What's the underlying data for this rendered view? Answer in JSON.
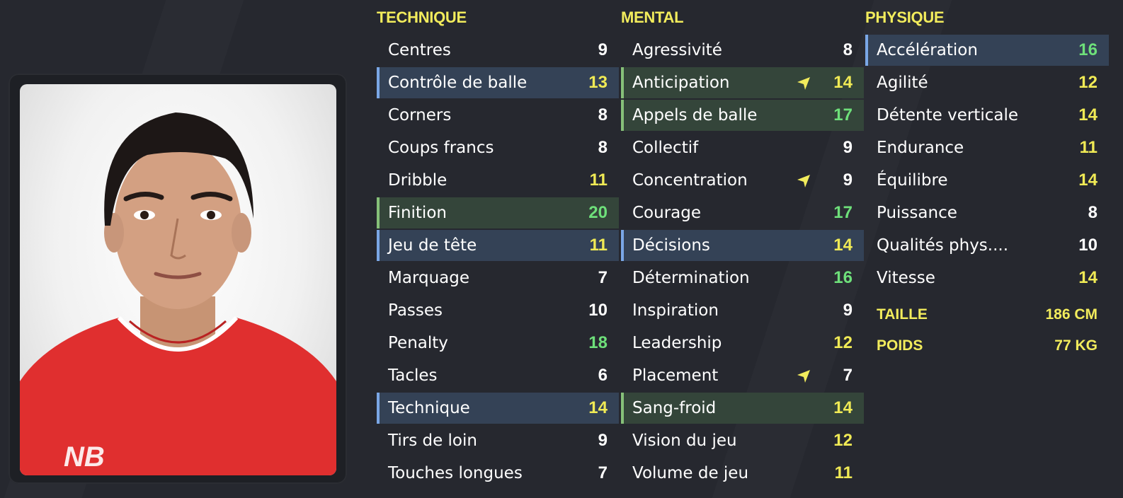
{
  "technique": {
    "title": "TECHNIQUE",
    "items": [
      {
        "label": "Centres",
        "value": "9",
        "color": "white",
        "highlight": ""
      },
      {
        "label": "Contrôle de balle",
        "value": "13",
        "color": "yellow",
        "highlight": "blue"
      },
      {
        "label": "Corners",
        "value": "8",
        "color": "white",
        "highlight": ""
      },
      {
        "label": "Coups francs",
        "value": "8",
        "color": "white",
        "highlight": ""
      },
      {
        "label": "Dribble",
        "value": "11",
        "color": "yellow",
        "highlight": ""
      },
      {
        "label": "Finition",
        "value": "20",
        "color": "green",
        "highlight": "green"
      },
      {
        "label": "Jeu de tête",
        "value": "11",
        "color": "yellow",
        "highlight": "blue"
      },
      {
        "label": "Marquage",
        "value": "7",
        "color": "white",
        "highlight": ""
      },
      {
        "label": "Passes",
        "value": "10",
        "color": "white",
        "highlight": ""
      },
      {
        "label": "Penalty",
        "value": "18",
        "color": "green",
        "highlight": ""
      },
      {
        "label": "Tacles",
        "value": "6",
        "color": "white",
        "highlight": ""
      },
      {
        "label": "Technique",
        "value": "14",
        "color": "yellow",
        "highlight": "blue"
      },
      {
        "label": "Tirs de loin",
        "value": "9",
        "color": "white",
        "highlight": ""
      },
      {
        "label": "Touches longues",
        "value": "7",
        "color": "white",
        "highlight": ""
      }
    ]
  },
  "mental": {
    "title": "MENTAL",
    "items": [
      {
        "label": "Agressivité",
        "value": "8",
        "color": "white",
        "highlight": ""
      },
      {
        "label": "Anticipation",
        "value": "14",
        "color": "yellow",
        "highlight": "green",
        "trend": "up-arrow-icon"
      },
      {
        "label": "Appels de balle",
        "value": "17",
        "color": "green",
        "highlight": "green"
      },
      {
        "label": "Collectif",
        "value": "9",
        "color": "white",
        "highlight": ""
      },
      {
        "label": "Concentration",
        "value": "9",
        "color": "white",
        "highlight": "",
        "trend": "up-arrow-icon"
      },
      {
        "label": "Courage",
        "value": "17",
        "color": "green",
        "highlight": ""
      },
      {
        "label": "Décisions",
        "value": "14",
        "color": "yellow",
        "highlight": "blue"
      },
      {
        "label": "Détermination",
        "value": "16",
        "color": "green",
        "highlight": ""
      },
      {
        "label": "Inspiration",
        "value": "9",
        "color": "white",
        "highlight": ""
      },
      {
        "label": "Leadership",
        "value": "12",
        "color": "yellow",
        "highlight": ""
      },
      {
        "label": "Placement",
        "value": "7",
        "color": "white",
        "highlight": "",
        "trend": "up-arrow-icon"
      },
      {
        "label": "Sang-froid",
        "value": "14",
        "color": "yellow",
        "highlight": "green"
      },
      {
        "label": "Vision du jeu",
        "value": "12",
        "color": "yellow",
        "highlight": ""
      },
      {
        "label": "Volume de jeu",
        "value": "11",
        "color": "yellow",
        "highlight": ""
      }
    ]
  },
  "physique": {
    "title": "PHYSIQUE",
    "items": [
      {
        "label": "Accélération",
        "value": "16",
        "color": "green",
        "highlight": "blue"
      },
      {
        "label": "Agilité",
        "value": "12",
        "color": "yellow",
        "highlight": ""
      },
      {
        "label": "Détente verticale",
        "value": "14",
        "color": "yellow",
        "highlight": ""
      },
      {
        "label": "Endurance",
        "value": "11",
        "color": "yellow",
        "highlight": ""
      },
      {
        "label": "Équilibre",
        "value": "14",
        "color": "yellow",
        "highlight": ""
      },
      {
        "label": "Puissance",
        "value": "8",
        "color": "white",
        "highlight": ""
      },
      {
        "label": "Qualités phys....",
        "value": "10",
        "color": "white",
        "highlight": ""
      },
      {
        "label": "Vitesse",
        "value": "14",
        "color": "yellow",
        "highlight": ""
      }
    ]
  },
  "info": {
    "height_label": "TAILLE",
    "height_value": "186 CM",
    "weight_label": "POIDS",
    "weight_value": "77 KG"
  },
  "colors": {
    "accent_yellow": "#f2ec5c",
    "value_green": "#6ee07a",
    "highlight_blue": "#344256",
    "highlight_green": "#34453a"
  }
}
